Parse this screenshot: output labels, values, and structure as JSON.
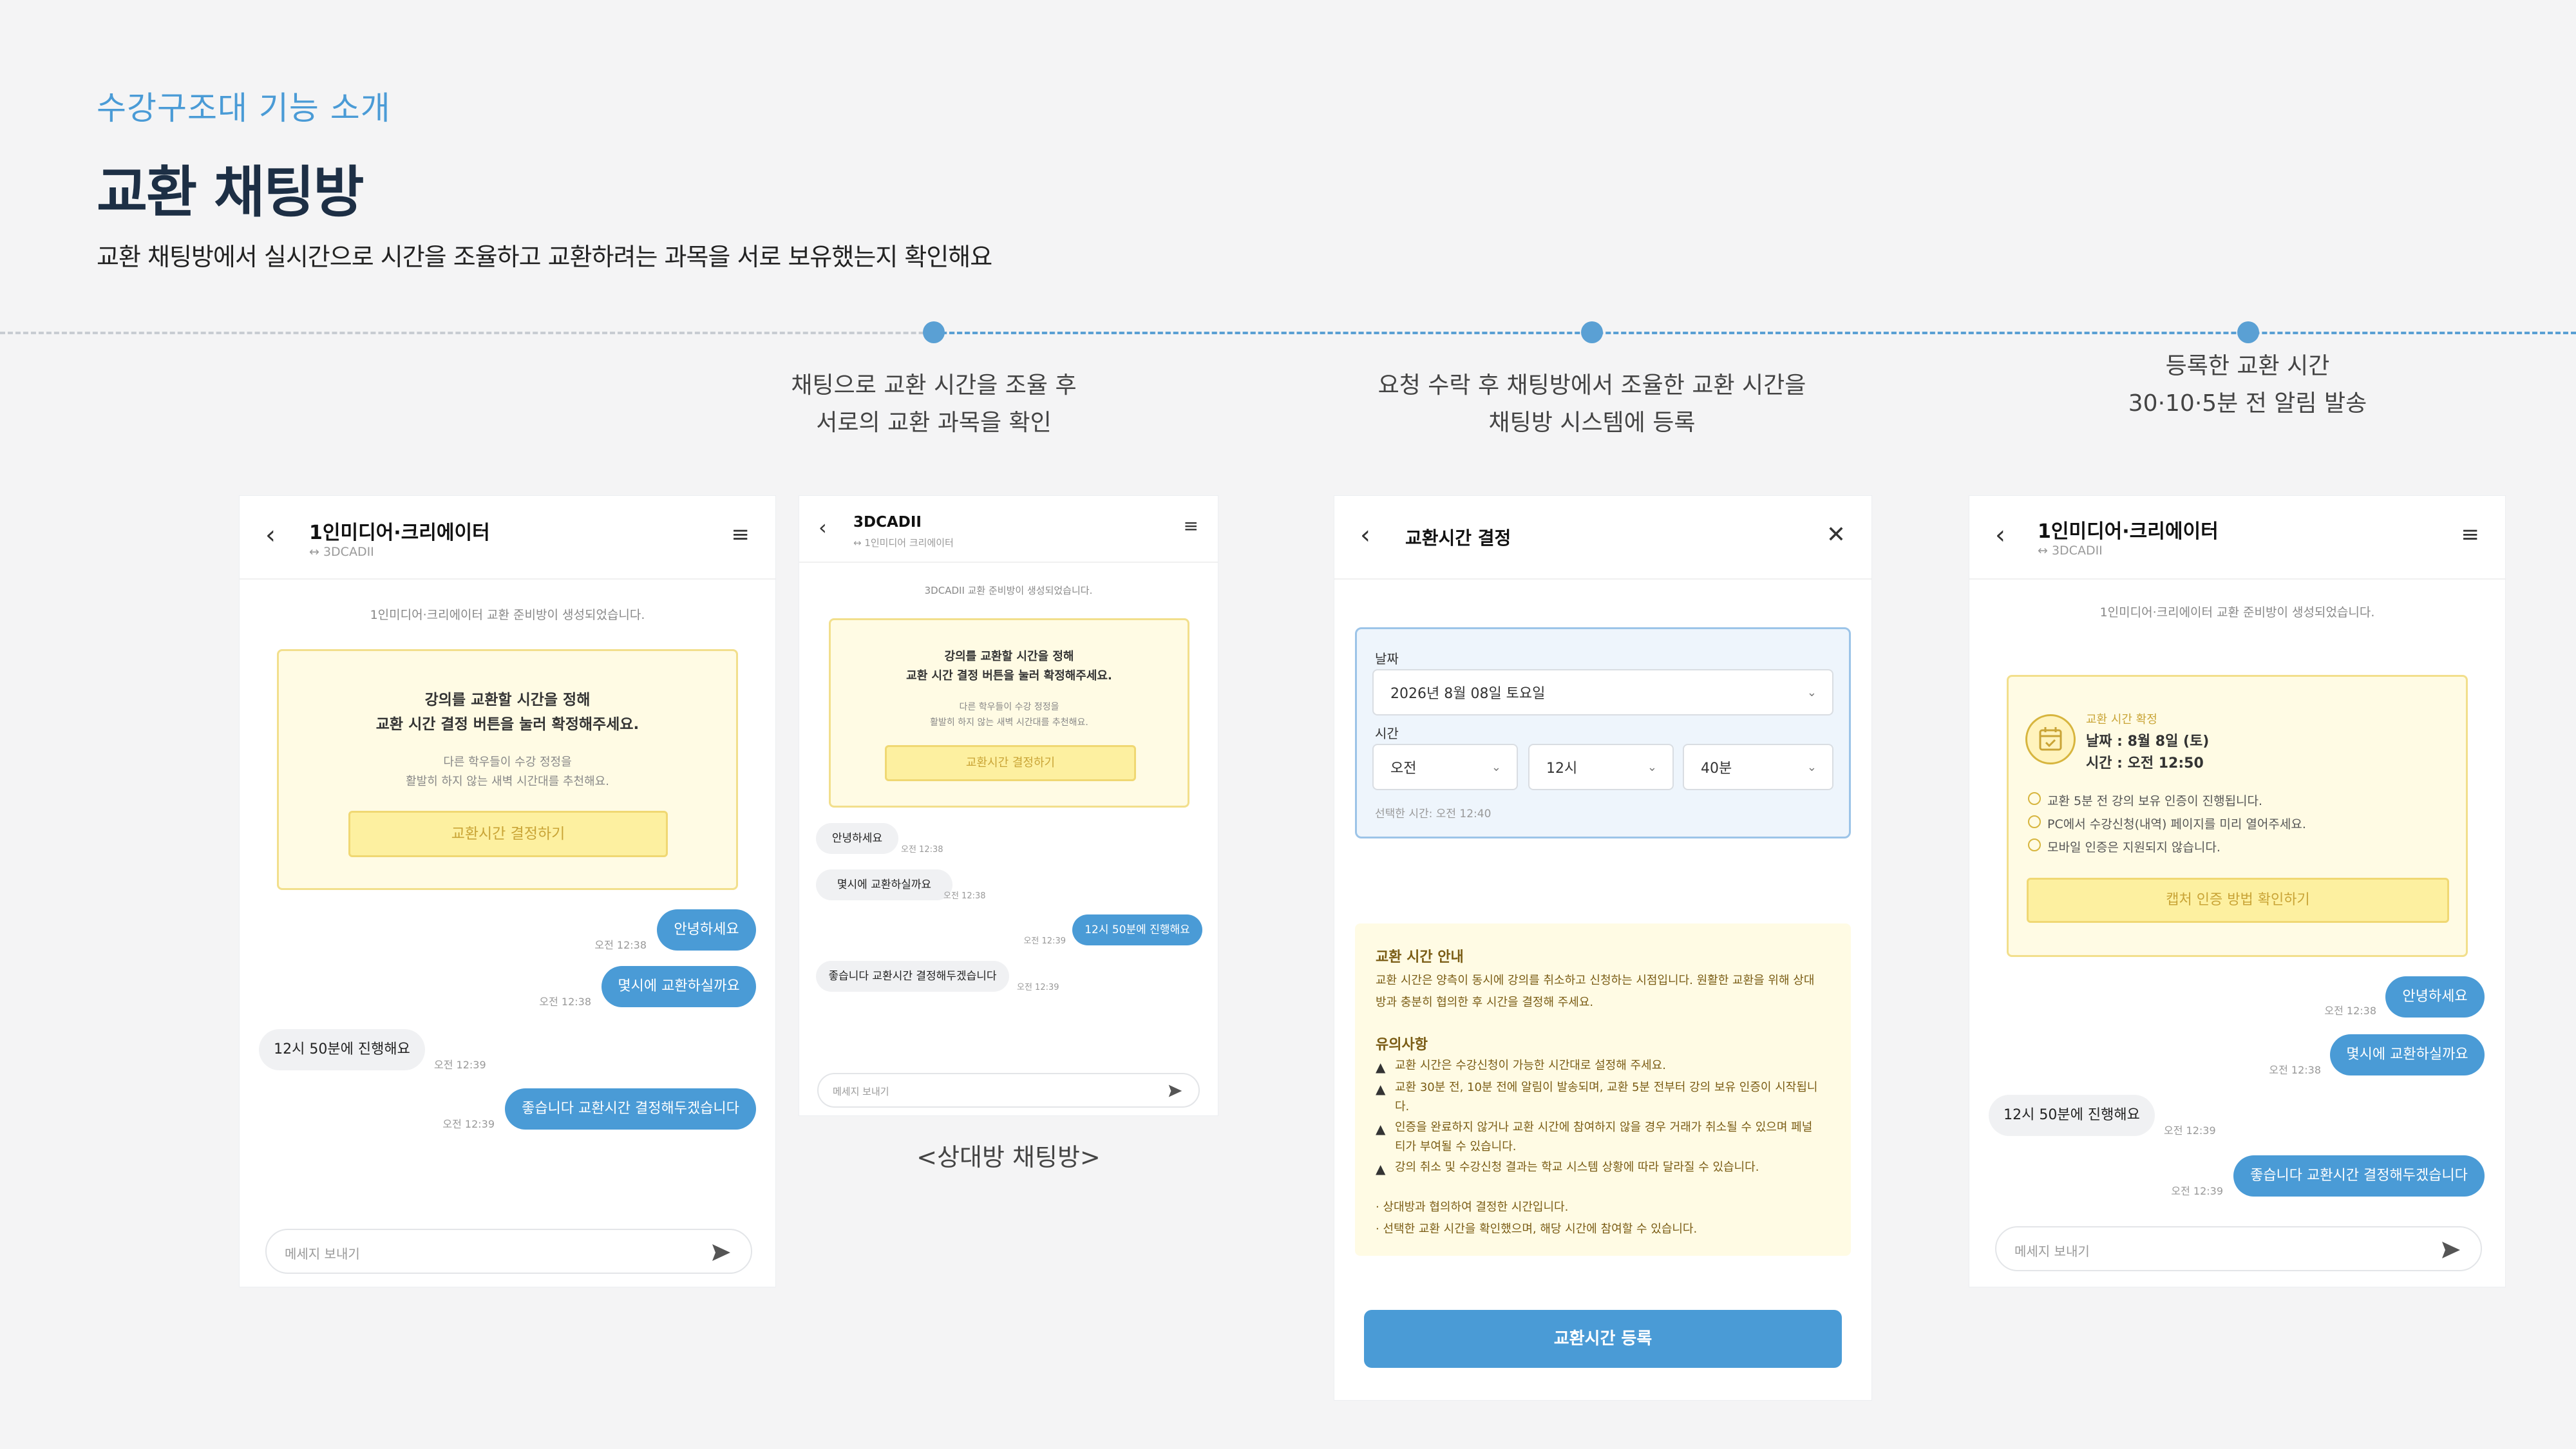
{
  "header": {
    "kicker": "수강구조대 기능 소개",
    "title": "교환 채팅방",
    "description": "교환 채팅방에서 실시간으로 시간을 조율하고  교환하려는 과목을 서로 보유했는지 확인해요"
  },
  "steps": [
    {
      "line1": "채팅으로 교환 시간을 조율 후",
      "line2": "서로의 교환 과목을 확인"
    },
    {
      "line1": "요청 수락 후 채팅방에서 조율한 교환 시간을",
      "line2": "채팅방 시스템에 등록"
    },
    {
      "line1": "등록한 교환 시간",
      "line2": "30·10·5분 전 알림 발송"
    }
  ],
  "chat_main": {
    "title": "1인미디어·크리에이터",
    "subtitle": "↔ 3DCADII",
    "system": "1인미디어·크리에이터 교환 준비방이 생성되었습니다.",
    "card_title1": "강의를 교환할 시간을 정해",
    "card_title2": "교환 시간 결정 버튼을 눌러 확정해주세요.",
    "card_sub1": "다른 학우들이 수강 정정을",
    "card_sub2": "활발히 하지 않는 새벽 시간대를 추천해요.",
    "card_button": "교환시간 결정하기",
    "messages": [
      {
        "text": "안녕하세요",
        "time": "오전 12:38"
      },
      {
        "text": "몇시에 교환하실까요",
        "time": "오전 12:38"
      },
      {
        "text": "12시 50분에 진행해요",
        "time": "오전 12:39"
      },
      {
        "text": "좋습니다 교환시간 결정해두겠습니다",
        "time": "오전 12:39"
      }
    ],
    "input_placeholder": "메세지 보내기"
  },
  "chat_partner": {
    "title": "3DCADII",
    "subtitle": "↔ 1인미디어 크리에이터",
    "system": "3DCADII 교환 준비방이 생성되었습니다.",
    "card_title1": "강의를 교환할 시간을 정해",
    "card_title2": "교환 시간 결정 버튼을 눌러 확정해주세요.",
    "card_sub1": "다른 학우들이 수강 정정을",
    "card_sub2": "활발히 하지 않는 새벽 시간대를 추천해요.",
    "card_button": "교환시간 결정하기",
    "messages": [
      {
        "text": "안녕하세요",
        "time": "오전 12:38"
      },
      {
        "text": "몇시에 교환하실까요",
        "time": "오전 12:38"
      },
      {
        "text": "12시 50분에 진행해요",
        "time": "오전 12:39"
      },
      {
        "text": "좋습니다 교환시간 결정해두겠습니다",
        "time": "오전 12:39"
      }
    ],
    "input_placeholder": "메세지 보내기",
    "caption": "<상대방 채팅방>"
  },
  "decide": {
    "title": "교환시간 결정",
    "date_label": "날짜",
    "date_value": "2026년 8월 08일 토요일",
    "time_label": "시간",
    "ampm": "오전",
    "hour": "12시",
    "minute": "40분",
    "selected_hint": "선택한 시간: 오전 12:40",
    "guide_title": "교환 시간 안내",
    "guide_text1": "교환 시간은 양측이 동시에 강의를 취소하고 신청하는 시점입니다. 원활한 교환을 위해 상대",
    "guide_text2": "방과 충분히 협의한 후 시간을 결정해 주세요.",
    "caution_title": "유의사항",
    "cautions": [
      "교환 시간은 수강신청이 가능한 시간대로 설정해 주세요.",
      "교환 30분 전, 10분 전에 알림이 발송되며, 교환 5분 전부터 강의 보유 인증이 시작됩니",
      "다.",
      "인증을 완료하지 않거나 교환 시간에 참여하지 않을 경우 거래가 취소될 수 있으며 페널",
      "티가 부여될 수 있습니다.",
      "강의 취소 및 수강신청 결과는 학교 시스템 상황에 따라 달라질 수 있습니다."
    ],
    "notes": [
      "· 상대방과 협의하여 결정한 시간입니다.",
      "· 선택한 교환 시간을 확인했으며, 해당 시간에 참여할 수 있습니다."
    ],
    "register_button": "교환시간 등록"
  },
  "chat_confirmed": {
    "title": "1인미디어·크리에이터",
    "subtitle": "↔ 3DCADII",
    "system": "1인미디어·크리에이터 교환 준비방이 생성되었습니다.",
    "confirm_label": "교환 시간 확정",
    "confirm_date": "날짜 : 8월 8일 (토)",
    "confirm_time": "시간 : 오전 12:50",
    "checks": [
      "교환 5분 전 강의 보유 인증이 진행됩니다.",
      "PC에서 수강신청(내역) 페이지를 미리 열어주세요.",
      "모바일 인증은 지원되지 않습니다."
    ],
    "card_button": "캡처 인증 방법 확인하기",
    "messages": [
      {
        "text": "안녕하세요",
        "time": "오전 12:38"
      },
      {
        "text": "몇시에 교환하실까요",
        "time": "오전 12:38"
      },
      {
        "text": "12시 50분에 진행해요",
        "time": "오전 12:39"
      },
      {
        "text": "좋습니다 교환시간 결정해두겠습니다",
        "time": "오전 12:39"
      }
    ],
    "input_placeholder": "메세지 보내기"
  },
  "colors": {
    "accent": "#4a9bd6",
    "title": "#1d2f45",
    "yellow_bg": "#fffbe4",
    "yellow_border": "#f2df8c"
  }
}
